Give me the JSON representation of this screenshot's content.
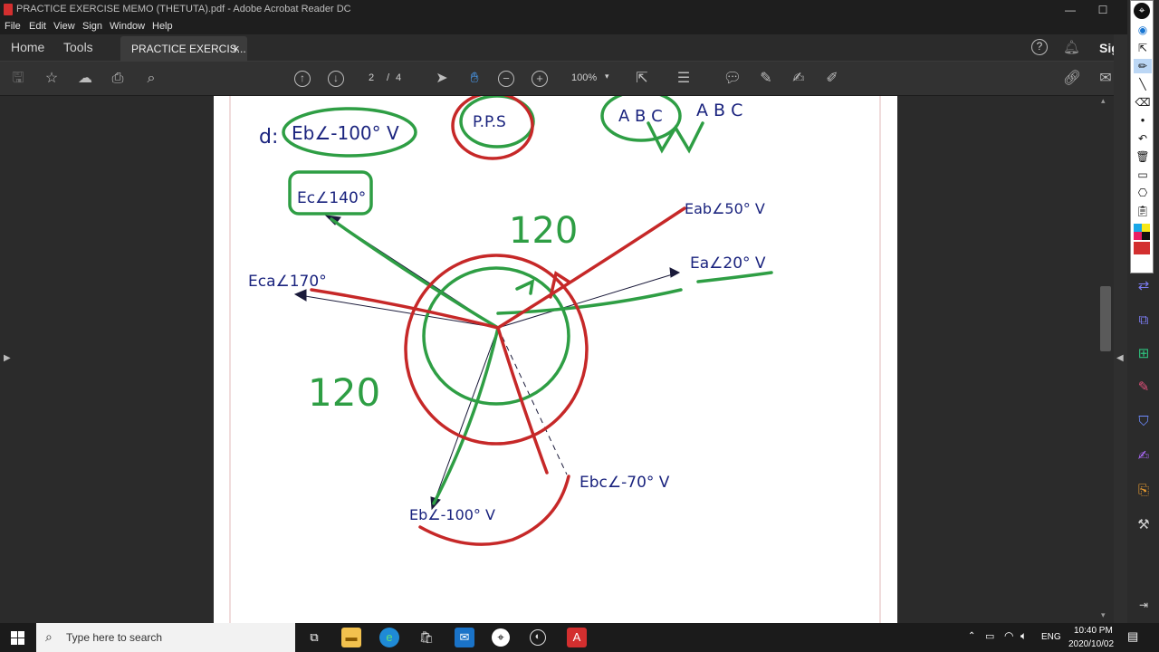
{
  "window": {
    "title": "PRACTICE EXERCISE MEMO (THETUTA).pdf - Adobe Acrobat Reader DC"
  },
  "menu": [
    "File",
    "Edit",
    "View",
    "Sign",
    "Window",
    "Help"
  ],
  "tabs": {
    "home": "Home",
    "tools": "Tools",
    "document": "PRACTICE EXERCIS...",
    "close": "×",
    "sign": "Sign"
  },
  "toolbar": {
    "page_current": "2",
    "page_sep": "/",
    "page_total": "4",
    "zoom": "100%"
  },
  "drawing": {
    "part_label": "d:",
    "top_eb": "Eb∠-100° V",
    "pps": "P.P.S",
    "abc1": "A B C",
    "abc2": "A B C",
    "ec": "Ec∠140°",
    "eab": "Eab∠50° V",
    "ea": "Ea∠20° V",
    "eca": "Eca∠170°",
    "ebc": "Ebc∠-70° V",
    "eb": "Eb∠-100° V",
    "angle_top": "120",
    "angle_left": "120"
  },
  "taskbar": {
    "search_placeholder": "Type here to search",
    "lang": "ENG",
    "time": "10:40 PM",
    "date": "2020/10/02"
  },
  "colors": {
    "red_pen": "#c62828",
    "green_pen": "#2e9e44",
    "ink": "#1a237e"
  }
}
